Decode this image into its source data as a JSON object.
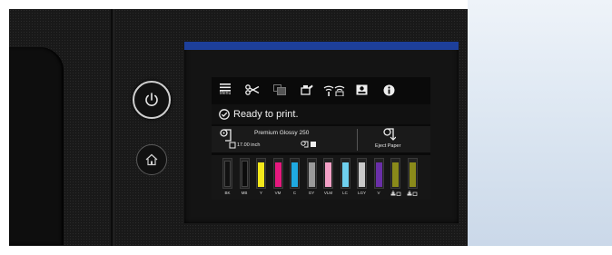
{
  "toolbar": {
    "menu_label": "Menu",
    "icons": [
      "menu-icon",
      "cut-icon",
      "copy-icon",
      "maintenance-icon",
      "wifi-direct-icon",
      "account-icon",
      "info-icon"
    ]
  },
  "status": {
    "message": "Ready to print.",
    "icon": "check-circle-icon"
  },
  "paper": {
    "media_name": "Premium Glossy 250",
    "media_size": "17.00 inch",
    "eject_label": "Eject Paper"
  },
  "inks": [
    {
      "code": "BK",
      "color": "#111111",
      "level": 0.9
    },
    {
      "code": "MB",
      "color": "#0c0c0c",
      "level": 0.9
    },
    {
      "code": "Y",
      "color": "#f4e81b",
      "level": 0.9
    },
    {
      "code": "VM",
      "color": "#e5197e",
      "level": 0.9
    },
    {
      "code": "C",
      "color": "#1fa9e1",
      "level": 0.9
    },
    {
      "code": "GY",
      "color": "#9a9a9a",
      "level": 0.9
    },
    {
      "code": "VLM",
      "color": "#f3a0c6",
      "level": 0.9
    },
    {
      "code": "LC",
      "color": "#6fd0ef",
      "level": 0.9
    },
    {
      "code": "LGY",
      "color": "#c9c9c9",
      "level": 0.9
    },
    {
      "code": "V",
      "color": "#6a2fa8",
      "level": 0.9
    },
    {
      "code": "maintenance-box-1",
      "color": "#8a8a1a",
      "level": 0.9
    },
    {
      "code": "maintenance-box-2",
      "color": "#8a8a1a",
      "level": 0.9
    }
  ],
  "colors": {
    "screen_blue_strip": "#1d3f9a",
    "power_ring": "#cfcfcf"
  }
}
